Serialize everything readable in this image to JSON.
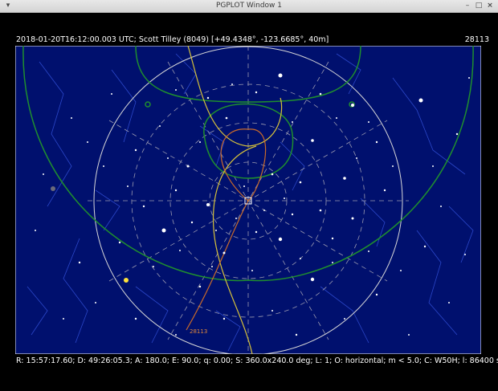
{
  "window": {
    "title": "PGPLOT Window 1",
    "menu_icon": "chevron-down-icon",
    "minimize_icon": "minimize-icon",
    "maximize_icon": "maximize-icon",
    "close_icon": "close-icon"
  },
  "header": {
    "info": "2018-01-20T16:12:00.003 UTC; Scott Tilley (8049) [+49.4348°, -123.6685°, 40m]",
    "satellite_id": "28113"
  },
  "plot": {
    "background": "#00106e",
    "track_label": "28113",
    "colors": {
      "horizon_circle": "#d8d8d8",
      "grid": "#9a9ab0",
      "constellations": "#2b47c9",
      "satellite_track": "#c96a2a",
      "ecliptic": "#d7c23a",
      "orbit_curves": "#1f8f2e",
      "stars": "#ffffff"
    }
  },
  "footer": {
    "status": "R: 15:57:17.60; D: 49:26:05.3; A: 180.0; E: 90.0; q: 0.00; S: 360.0x240.0 deg; L: 1; O: horizontal; m < 5.0; C: W50H; l: 86400 s"
  }
}
